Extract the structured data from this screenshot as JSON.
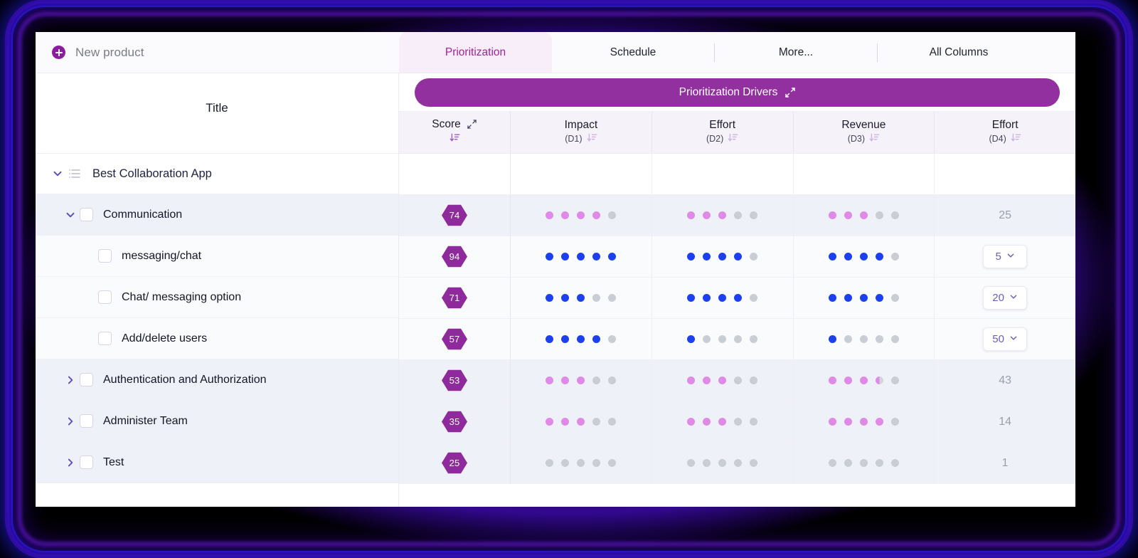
{
  "app": {
    "new_product_label": "New product",
    "add_icon": "plus-circle-icon"
  },
  "tabs": [
    {
      "label": "Prioritization",
      "active": true
    },
    {
      "label": "Schedule",
      "active": false
    },
    {
      "label": "More...",
      "active": false
    },
    {
      "label": "All Columns",
      "active": false
    }
  ],
  "drivers": {
    "label": "Prioritization Drivers",
    "expand_icon": "expand-diagonal-icon",
    "color": "#93309f"
  },
  "left_column": {
    "header": "Title"
  },
  "columns": [
    {
      "key": "score",
      "title": "Score",
      "sub": "",
      "has_expand": true,
      "sort_icon": "sort-descending-icon",
      "sort_active": true
    },
    {
      "key": "impact",
      "title": "Impact",
      "sub": "(D1)",
      "has_expand": false,
      "sort_icon": "sort-descending-icon",
      "sort_active": false
    },
    {
      "key": "effort2",
      "title": "Effort",
      "sub": "(D2)",
      "has_expand": false,
      "sort_icon": "sort-descending-icon",
      "sort_active": false
    },
    {
      "key": "revenue",
      "title": "Revenue",
      "sub": "(D3)",
      "has_expand": false,
      "sort_icon": "sort-descending-icon",
      "sort_active": false
    },
    {
      "key": "effort4",
      "title": "Effort",
      "sub": "(D4)",
      "has_expand": false,
      "sort_icon": "sort-descending-icon",
      "sort_active": false
    }
  ],
  "rows": [
    {
      "id": "best-collaboration-app",
      "title": "Best Collaboration App",
      "level": 0,
      "kind": "group",
      "expanded": true,
      "has_checkbox": false,
      "has_list_icon": true,
      "shade": "white",
      "score": null,
      "impact": null,
      "effort2": null,
      "revenue": null,
      "effort4": null
    },
    {
      "id": "communication",
      "title": "Communication",
      "level": 1,
      "kind": "parent",
      "expanded": true,
      "has_checkbox": true,
      "has_list_icon": false,
      "shade": "shaded",
      "score": "74",
      "impact": [
        "pink",
        "pink",
        "pink",
        "pink",
        "empty"
      ],
      "effort2": [
        "pink",
        "pink",
        "pink",
        "empty",
        "empty"
      ],
      "revenue": [
        "pink",
        "pink",
        "pink",
        "empty",
        "empty"
      ],
      "effort4": {
        "type": "text",
        "value": "25"
      }
    },
    {
      "id": "messaging-chat",
      "title": "messaging/chat",
      "level": 2,
      "kind": "child",
      "expanded": null,
      "has_checkbox": true,
      "has_list_icon": false,
      "shade": "light",
      "score": "94",
      "impact": [
        "blue",
        "blue",
        "blue",
        "blue",
        "blue"
      ],
      "effort2": [
        "blue",
        "blue",
        "blue",
        "blue",
        "empty"
      ],
      "revenue": [
        "blue",
        "blue",
        "blue",
        "blue",
        "empty"
      ],
      "effort4": {
        "type": "select",
        "value": "5"
      }
    },
    {
      "id": "chat-messaging-option",
      "title": "Chat/ messaging option",
      "level": 2,
      "kind": "child",
      "expanded": null,
      "has_checkbox": true,
      "has_list_icon": false,
      "shade": "light",
      "score": "71",
      "impact": [
        "blue",
        "blue",
        "blue",
        "empty",
        "empty"
      ],
      "effort2": [
        "blue",
        "blue",
        "blue",
        "blue",
        "empty"
      ],
      "revenue": [
        "blue",
        "blue",
        "blue",
        "blue",
        "empty"
      ],
      "effort4": {
        "type": "select",
        "value": "20"
      }
    },
    {
      "id": "add-delete-users",
      "title": "Add/delete users",
      "level": 2,
      "kind": "child",
      "expanded": null,
      "has_checkbox": true,
      "has_list_icon": false,
      "shade": "light",
      "score": "57",
      "impact": [
        "blue",
        "blue",
        "blue",
        "blue",
        "empty"
      ],
      "effort2": [
        "blue",
        "empty",
        "empty",
        "empty",
        "empty"
      ],
      "revenue": [
        "blue",
        "empty",
        "empty",
        "empty",
        "empty"
      ],
      "effort4": {
        "type": "select",
        "value": "50"
      }
    },
    {
      "id": "authentication-and-authorization",
      "title": "Authentication and Authorization",
      "level": 1,
      "kind": "parent",
      "expanded": false,
      "has_checkbox": true,
      "has_list_icon": false,
      "shade": "shaded",
      "score": "53",
      "impact": [
        "pink",
        "pink",
        "pink",
        "empty",
        "empty"
      ],
      "effort2": [
        "pink",
        "pink",
        "pink",
        "empty",
        "empty"
      ],
      "revenue": [
        "pink",
        "pink",
        "pink",
        "half",
        "empty"
      ],
      "effort4": {
        "type": "text",
        "value": "43"
      }
    },
    {
      "id": "administer-team",
      "title": "Administer Team",
      "level": 1,
      "kind": "parent",
      "expanded": false,
      "has_checkbox": true,
      "has_list_icon": false,
      "shade": "shaded",
      "score": "35",
      "impact": [
        "pink",
        "pink",
        "pink",
        "empty",
        "empty"
      ],
      "effort2": [
        "pink",
        "pink",
        "pink",
        "empty",
        "empty"
      ],
      "revenue": [
        "pink",
        "pink",
        "pink",
        "pink",
        "empty"
      ],
      "effort4": {
        "type": "text",
        "value": "14"
      }
    },
    {
      "id": "test",
      "title": "Test",
      "level": 1,
      "kind": "parent",
      "expanded": false,
      "has_checkbox": true,
      "has_list_icon": false,
      "shade": "shaded",
      "score": "25",
      "impact": [
        "empty",
        "empty",
        "empty",
        "empty",
        "empty"
      ],
      "effort2": [
        "empty",
        "empty",
        "empty",
        "empty",
        "empty"
      ],
      "revenue": [
        "empty",
        "empty",
        "empty",
        "empty",
        "empty"
      ],
      "effort4": {
        "type": "text",
        "value": "1"
      }
    }
  ],
  "colors": {
    "accent_purple": "#93309f",
    "tab_active": "#a3219b",
    "dot_blue": "#1c3ff0",
    "dot_pink": "#e08ae8",
    "dot_empty": "#c9cdd4",
    "select_text": "#6b5cc4",
    "glow": "#2a1fd6"
  }
}
